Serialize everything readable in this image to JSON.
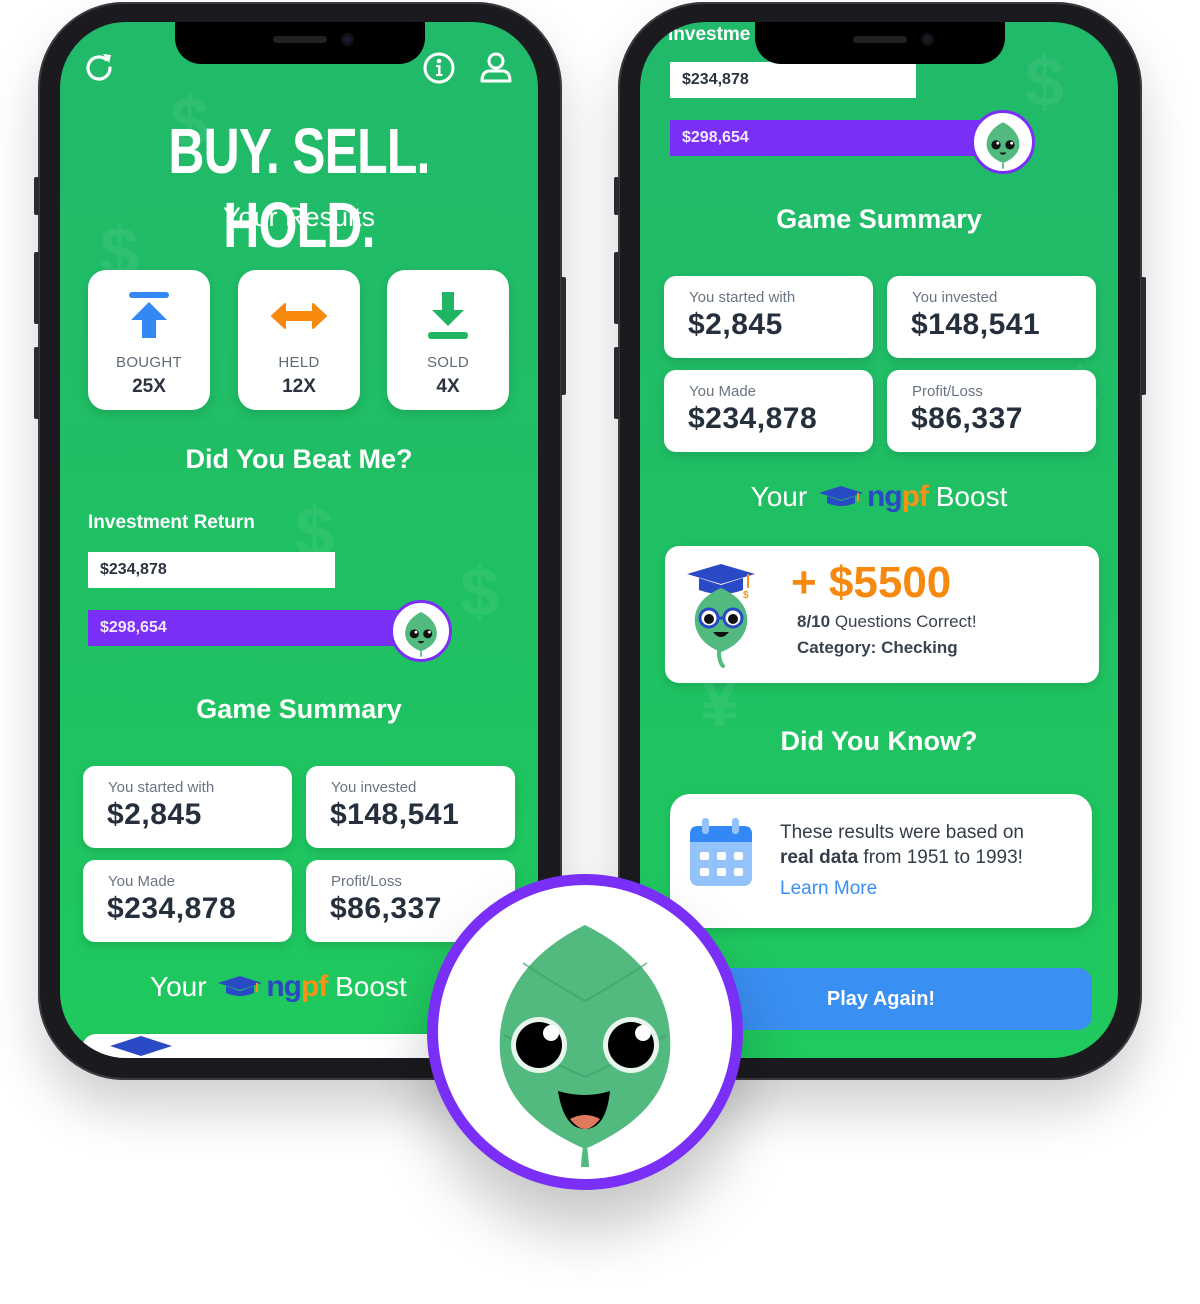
{
  "left_phone": {
    "top_icons": {
      "refresh": "refresh-icon",
      "info": "info-icon",
      "profile": "user-profile-icon"
    },
    "headline": "BUY. SELL. HOLD.",
    "results_title": "Your Results",
    "results": [
      {
        "label": "BOUGHT",
        "value": "25X",
        "icon": "arrow-up-bar-icon",
        "color": "#3388f5"
      },
      {
        "label": "HELD",
        "value": "12X",
        "icon": "double-arrow-horizontal-icon",
        "color": "#f78a0e"
      },
      {
        "label": "SOLD",
        "value": "4X",
        "icon": "download-arrow-icon",
        "color": "#21b463"
      }
    ],
    "beat_title": "Did You Beat Me?",
    "investment_label": "Investment Return",
    "investment": {
      "player": {
        "value": "$234,878",
        "fraction": 0.79
      },
      "mascot": {
        "value": "$298,654",
        "fraction": 1.0
      }
    },
    "summary_title": "Game Summary",
    "summary": [
      {
        "label": "You started with",
        "value": "$2,845"
      },
      {
        "label": "You invested",
        "value": "$148,541"
      },
      {
        "label": "You Made",
        "value": "$234,878"
      },
      {
        "label": "Profit/Loss",
        "value": "$86,337"
      }
    ],
    "boost_title_prefix": "Your",
    "boost_title_suffix": "Boost"
  },
  "right_phone": {
    "investment_label_partial": "Investme",
    "investment": {
      "player": {
        "value": "$234,878",
        "fraction": 0.79
      },
      "mascot": {
        "value": "$298,654",
        "fraction": 1.0
      }
    },
    "summary_title": "Game Summary",
    "summary": [
      {
        "label": "You started with",
        "value": "$2,845"
      },
      {
        "label": "You invested",
        "value": "$148,541"
      },
      {
        "label": "You Made",
        "value": "$234,878"
      },
      {
        "label": "Profit/Loss",
        "value": "$86,337"
      }
    ],
    "boost_title_prefix": "Your",
    "boost_title_suffix": "Boost",
    "brand": {
      "ng": "ng",
      "pf": "pf"
    },
    "boost": {
      "amount": "+ $5500",
      "questions_bold": "8/10",
      "questions_rest": " Questions Correct!",
      "category": "Category: Checking"
    },
    "did_you_know_title": "Did You Know?",
    "did_you_know": {
      "line1": "These results were based on",
      "bold": "real data",
      "line2_rest": " from 1951 to 1993!",
      "link": "Learn More"
    },
    "play_again": "Play Again!"
  },
  "colors": {
    "screen_green": "#1fbf64",
    "purple": "#7a2ff7",
    "blue_button": "#3a8ff2",
    "orange": "#f78a0e",
    "mascot_green": "#52b97f"
  }
}
